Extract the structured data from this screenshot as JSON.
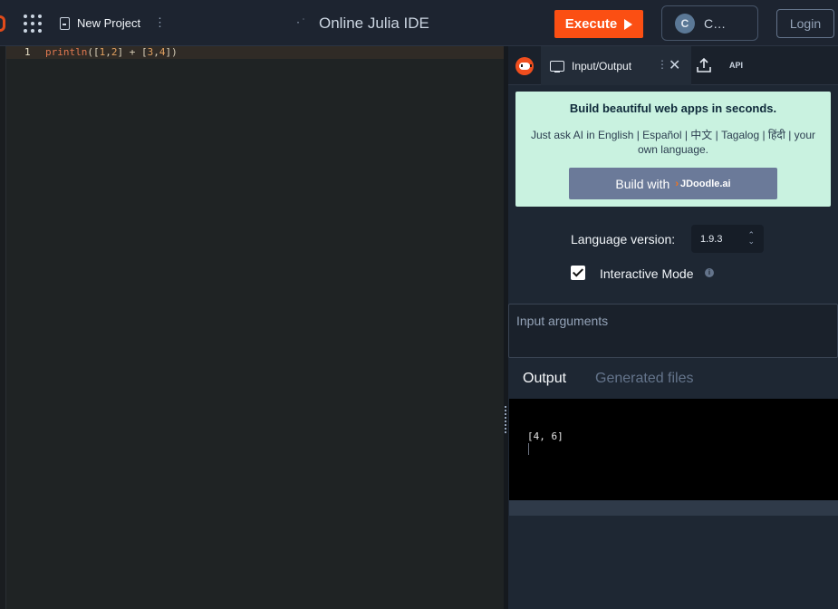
{
  "header": {
    "project_name": "New Project",
    "title": "Online Julia IDE",
    "execute_label": "Execute",
    "language_chip_label": "C…",
    "language_chip_logo": "C",
    "login_label": "Login",
    "colors": {
      "execute": "#fb4f13",
      "topbar": "#1d2430"
    }
  },
  "editor": {
    "lines": [
      {
        "number": "1",
        "code": "println([1,2] + [3,4])"
      }
    ]
  },
  "panel": {
    "tabs": {
      "io_label": "Input/Output",
      "api_label": "API"
    },
    "promo": {
      "title": "Build beautiful web apps in seconds.",
      "subtitle": "Just ask AI in English | Español | 中文 | Tagalog | हिंदी | your own language.",
      "button_label": "Build with",
      "button_brand": "JDoodle.ai",
      "background": "#c9f2e0"
    },
    "language_version": {
      "label": "Language version:",
      "value": "1.9.3"
    },
    "interactive_mode": {
      "label": "Interactive Mode",
      "checked": true
    },
    "input_args": {
      "placeholder": "Input arguments"
    },
    "output_tabs": {
      "output": "Output",
      "generated": "Generated files"
    },
    "output_text": "[4, 6]"
  }
}
